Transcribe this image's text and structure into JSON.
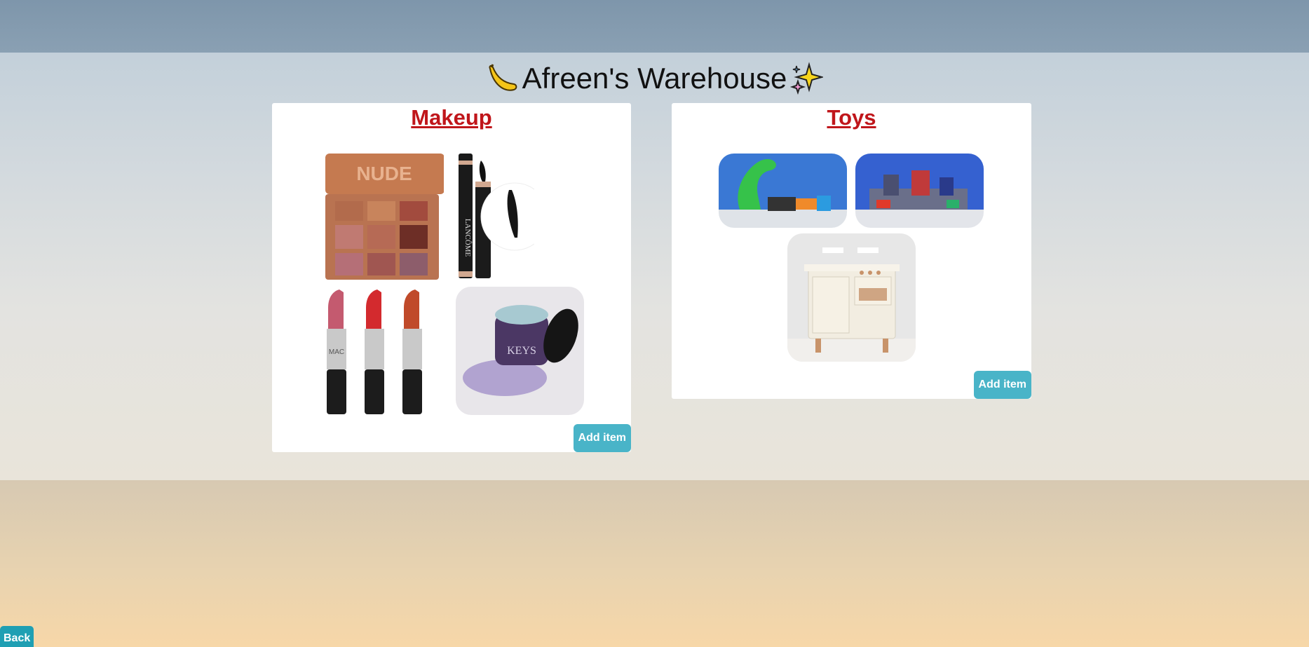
{
  "header": {
    "title": "Afreen's Warehouse",
    "left_icon": "banana-icon",
    "right_icon": "sparkles-icon"
  },
  "categories": [
    {
      "title": "Makeup",
      "add_label": "Add item",
      "items": [
        {
          "name": "eyeshadow-palette",
          "label": "NUDE"
        },
        {
          "name": "mascara",
          "label": "LANCÔME"
        },
        {
          "name": "lipsticks",
          "label": "MAC"
        },
        {
          "name": "cream-jar",
          "label": "KEYS"
        }
      ]
    },
    {
      "title": "Toys",
      "add_label": "Add item",
      "items": [
        {
          "name": "snake-track-toy"
        },
        {
          "name": "castle-playset"
        },
        {
          "name": "play-kitchen"
        }
      ]
    }
  ],
  "footer": {
    "back_label": "Back"
  },
  "colors": {
    "accent": "#49b4c8",
    "title_red": "#c0161b",
    "back": "#1f9fb3"
  }
}
